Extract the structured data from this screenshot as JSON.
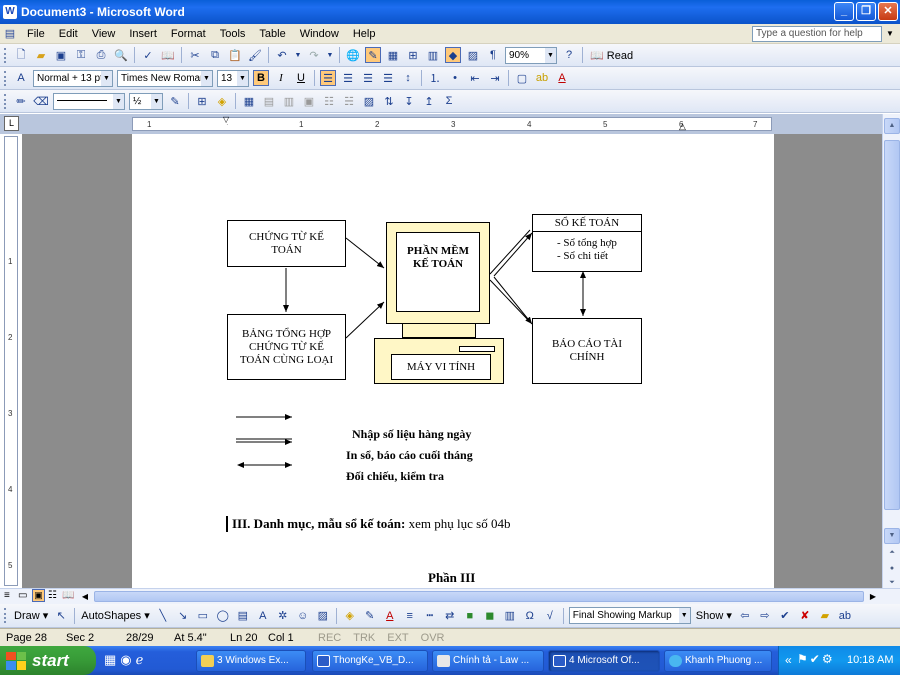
{
  "window": {
    "title": "Document3 - Microsoft Word",
    "app_icon": "W"
  },
  "menu": {
    "items": [
      "File",
      "Edit",
      "View",
      "Insert",
      "Format",
      "Tools",
      "Table",
      "Window",
      "Help"
    ],
    "help_placeholder": "Type a question for help"
  },
  "toolbar_standard": {
    "zoom": "90%",
    "read_label": "Read"
  },
  "toolbar_formatting": {
    "style": "Normal + 13 pt",
    "font": "Times New Roman",
    "size": "13",
    "bold_active": true
  },
  "toolbar_tables": {
    "line_weight": "½"
  },
  "ruler": {
    "h_marks": [
      "1",
      "1",
      "2",
      "3",
      "4",
      "5",
      "6",
      "7"
    ],
    "v_marks": [
      "1",
      "2",
      "3",
      "4",
      "5"
    ]
  },
  "diagram": {
    "box_chung_tu": "CHỨNG TỪ KẾ TOÁN",
    "box_bang_tong_hop": "BẢNG TỔNG HỢP CHỨNG TỪ KẾ TOÁN CÙNG LOẠI",
    "box_phan_mem": "PHẦN MỀM KẾ TOÁN",
    "box_may_vi_tinh": "MÁY VI TÍNH",
    "box_so_ke_toan_title": "SỔ KẾ TOÁN",
    "box_so_ke_toan_line1": "- Sổ tổng hợp",
    "box_so_ke_toan_line2": "- Sổ chi tiết",
    "box_bao_cao": "BÁO CÁO TÀI CHÍNH"
  },
  "legend": {
    "item1": "Nhập số liệu hàng  ngày",
    "item2": "In sổ, báo cáo cuối tháng",
    "item3": "Đối chiếu, kiểm tra"
  },
  "document": {
    "section_heading": "III. Danh mục, mẫu sổ kế toán:",
    "section_text": " xem phụ lục số 04b",
    "part_heading": "Phần III"
  },
  "drawing_toolbar": {
    "draw_label": "Draw",
    "autoshapes_label": "AutoShapes",
    "markup_mode": "Final Showing Markup",
    "show_label": "Show"
  },
  "status": {
    "page": "Page 28",
    "sec": "Sec 2",
    "count": "28/29",
    "at": "At 5.4\"",
    "ln": "Ln 20",
    "col": "Col 1",
    "rec": "REC",
    "trk": "TRK",
    "ext": "EXT",
    "ovr": "OVR"
  },
  "taskbar": {
    "start_label": "start",
    "tasks": [
      "3 Windows Ex...",
      "ThongKe_VB_D...",
      "Chính tả - Law ...",
      "4 Microsoft Of...",
      "Khanh Phuong ..."
    ],
    "clock": "10:18 AM"
  },
  "colors": {
    "titlebar": "#0b5fd9",
    "computer_fill": "#fff7c6",
    "taskbar": "#245edb",
    "start": "#3a9a3a"
  }
}
